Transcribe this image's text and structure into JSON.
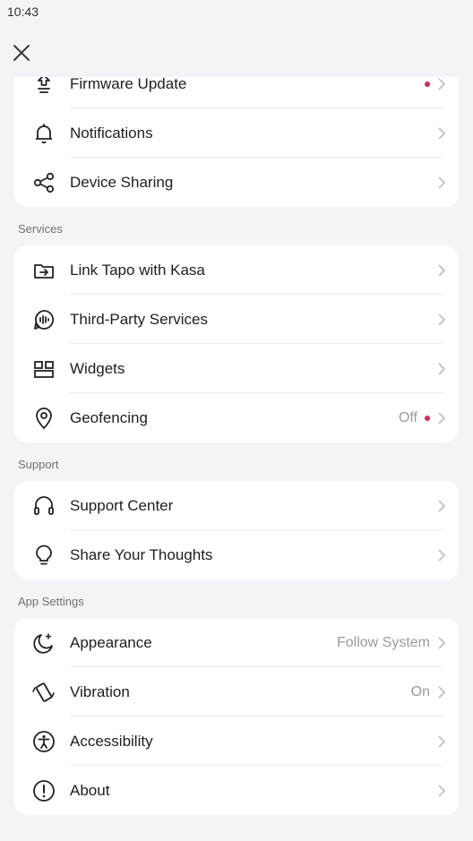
{
  "status": {
    "time": "10:43"
  },
  "header": {
    "close_icon": "close-icon"
  },
  "top_card": {
    "items": [
      {
        "label": "Firmware Update",
        "icon": "firmware-upload-icon",
        "badge": true,
        "value": ""
      },
      {
        "label": "Notifications",
        "icon": "bell-icon",
        "badge": false,
        "value": ""
      },
      {
        "label": "Device Sharing",
        "icon": "share-icon",
        "badge": false,
        "value": ""
      }
    ]
  },
  "services": {
    "title": "Services",
    "items": [
      {
        "label": "Link Tapo with Kasa",
        "icon": "link-folder-icon",
        "badge": false,
        "value": ""
      },
      {
        "label": "Third-Party Services",
        "icon": "voice-assistant-icon",
        "badge": false,
        "value": ""
      },
      {
        "label": "Widgets",
        "icon": "widgets-icon",
        "badge": false,
        "value": ""
      },
      {
        "label": "Geofencing",
        "icon": "location-pin-icon",
        "badge": true,
        "value": "Off"
      }
    ]
  },
  "support": {
    "title": "Support",
    "items": [
      {
        "label": "Support Center",
        "icon": "headset-icon",
        "badge": false,
        "value": ""
      },
      {
        "label": "Share Your Thoughts",
        "icon": "lightbulb-icon",
        "badge": false,
        "value": ""
      }
    ]
  },
  "app_settings": {
    "title": "App Settings",
    "items": [
      {
        "label": "Appearance",
        "icon": "moon-icon",
        "badge": false,
        "value": "Follow System"
      },
      {
        "label": "Vibration",
        "icon": "vibration-icon",
        "badge": false,
        "value": "On"
      },
      {
        "label": "Accessibility",
        "icon": "accessibility-icon",
        "badge": false,
        "value": ""
      },
      {
        "label": "About",
        "icon": "info-icon",
        "badge": false,
        "value": ""
      }
    ]
  },
  "colors": {
    "badge": "#e0264f",
    "background": "#f3f4f7",
    "card": "#ffffff"
  }
}
